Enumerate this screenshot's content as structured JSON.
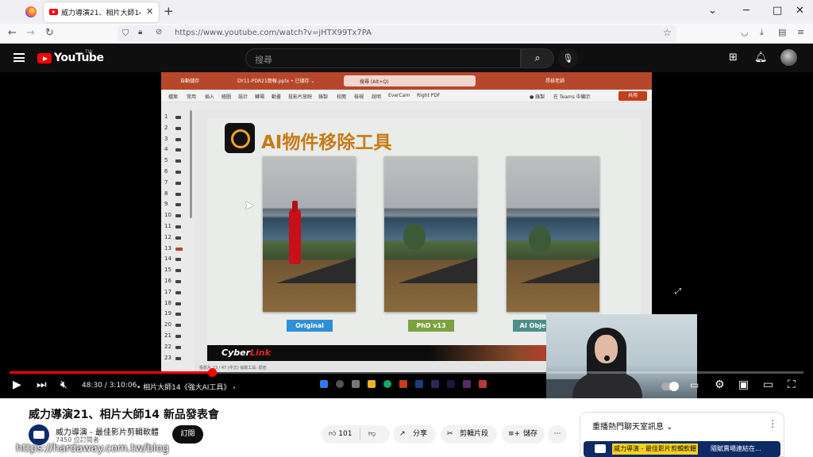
{
  "browser": {
    "tab_title": "威力導演21、相片大師14 新品發表會",
    "tab_close": "✕",
    "new_tab": "+",
    "url": "https://www.youtube.com/watch?v=jHTX99Tx7PA",
    "win_min": "─",
    "win_max": "□",
    "win_close": "✕",
    "chevron": "⌄"
  },
  "youtube": {
    "logo_text": "YouTube",
    "logo_region": "TW",
    "search_placeholder": "搜尋"
  },
  "slide": {
    "app_autosave": "自動儲存",
    "file_name": "DY11-PDR21簡報.pptx • 已儲存 ⌄",
    "search_text": "搜尋 (Alt+Q)",
    "user_name": "昂核老師",
    "menu_items": [
      "檔案",
      "常用",
      "插入",
      "繪圖",
      "設計",
      "轉場",
      "動畫",
      "投影片放映",
      "錄製",
      "校閱",
      "檢視",
      "說明",
      "EverCam",
      "Right PDF"
    ],
    "menu_right": [
      "● 錄製",
      "在 Teams 中顯示"
    ],
    "share_label": "共用",
    "title": "AI物件移除工具",
    "labels": [
      "Original",
      "PhD v13",
      "AI Obje"
    ],
    "label_colors": [
      "#2f8fd8",
      "#7ba23f",
      "#4c8f8a"
    ],
    "brand_cyber": "Cyber",
    "brand_link": "Link",
    "slide_numbers": [
      "1",
      "2",
      "3",
      "4",
      "5",
      "6",
      "7",
      "8",
      "9",
      "10",
      "11",
      "12",
      "13",
      "14",
      "15",
      "16",
      "17",
      "18",
      "19",
      "20",
      "21",
      "22",
      "23"
    ],
    "current_slide": "13",
    "status_text": "投影片 13 / 47   (中文)   協助工具: 調查"
  },
  "controls": {
    "time": "48:30 / 3:10:06",
    "chapter": "• 相片大師14《強大AI工具》 ›",
    "progress_fraction": 0.255,
    "accent": "#ff0000"
  },
  "video": {
    "title": "威力導演21、相片大師14 新品發表會",
    "channel_name": "威力導演 - 最佳影片剪輯軟體",
    "subscribers": "7450 位訂閱者",
    "subscribe_label": "訂閱",
    "likes": "101",
    "share_label": "分享",
    "clip_label": "剪輯片段",
    "save_label": "儲存",
    "more_label": "⋯"
  },
  "chat": {
    "title": "重播熱門聊天室訊息 ⌄",
    "more": "⋮",
    "highlight_author": "威力導演 - 最佳影片剪輯軟體",
    "message": "隨賦賣場連結在…"
  },
  "watermark": "https://hardaway.com.tw/blog"
}
